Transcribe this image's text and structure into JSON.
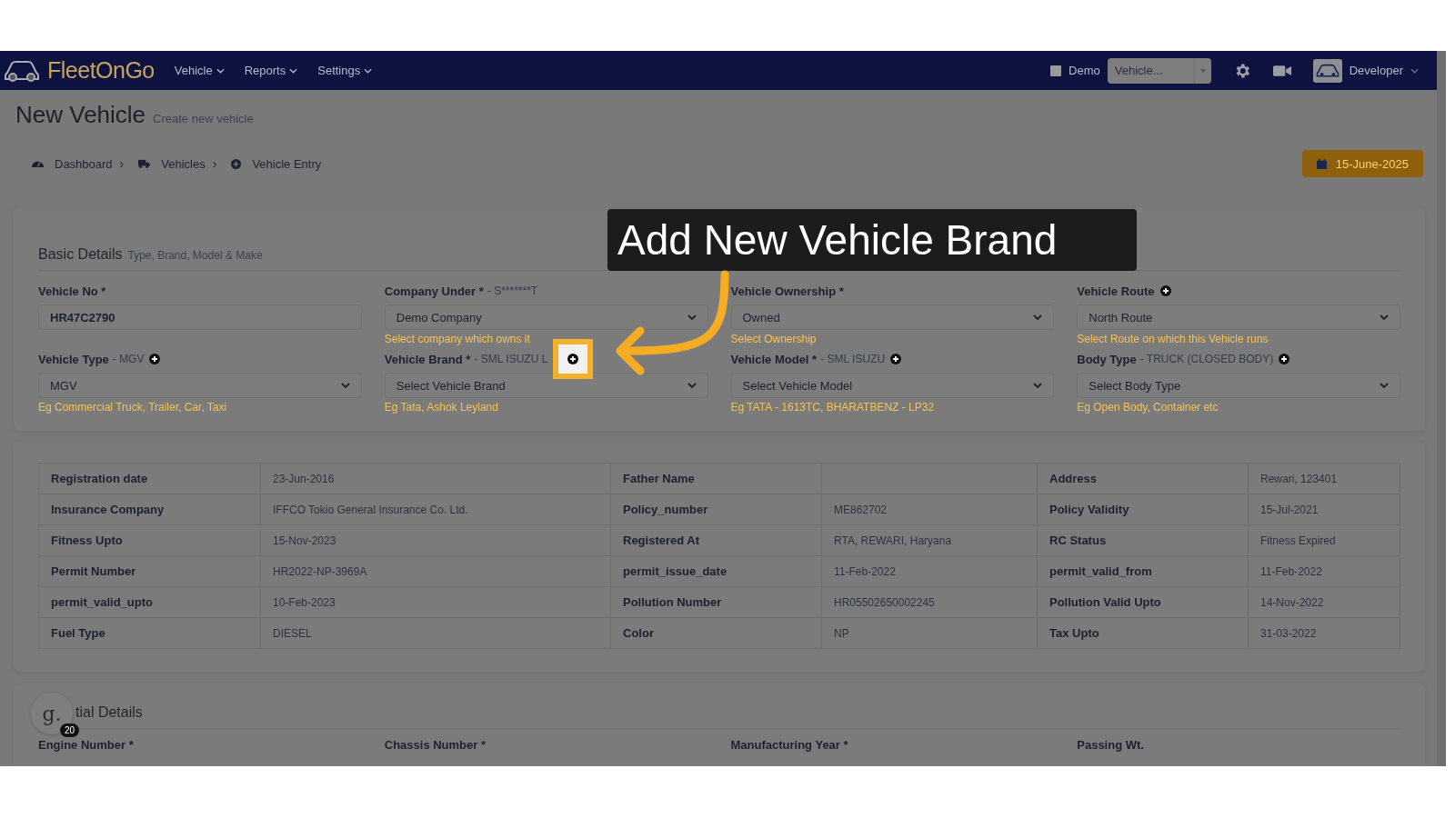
{
  "navbar": {
    "logo": "FleetOnGo",
    "menu": [
      {
        "label": "Vehicle"
      },
      {
        "label": "Reports"
      },
      {
        "label": "Settings"
      }
    ],
    "demo": {
      "label": "Demo",
      "checked": false
    },
    "vehicle_select": {
      "value": "Vehicle..."
    },
    "user": "Developer"
  },
  "page": {
    "title": "New Vehicle",
    "subtitle": "Create new vehicle"
  },
  "breadcrumb": [
    {
      "label": "Dashboard",
      "separator": "›"
    },
    {
      "label": "Vehicles",
      "separator": "›"
    },
    {
      "label": "Vehicle Entry"
    }
  ],
  "date": "15-June-2025",
  "basic": {
    "title": "Basic Details",
    "subtitle": "Type, Brand, Model & Make",
    "fields": [
      {
        "label": "Vehicle No *",
        "kind": "input",
        "value": "HR47C2790",
        "add": false
      },
      {
        "label": "Company Under *",
        "note": "- S*******T",
        "kind": "select",
        "value": "Demo Company",
        "hint": "Select company which owns it",
        "add": false
      },
      {
        "label": "Vehicle Ownership *",
        "kind": "select",
        "value": "Owned",
        "hint": "Select Ownership",
        "add": false
      },
      {
        "label": "Vehicle Route",
        "kind": "select",
        "value": "North Route",
        "hint": "Select Route on which this Vehicle runs",
        "add": true,
        "highlighted": false
      },
      {
        "label": "Vehicle Type",
        "note": "- MGV",
        "kind": "select",
        "value": "MGV",
        "hint": "Eg Commercial Truck, Trailer, Car, Taxi",
        "add": true,
        "highlighted": false
      },
      {
        "label": "Vehicle Brand *",
        "note": "- SML ISUZU L",
        "kind": "select",
        "value": "Select Vehicle Brand",
        "hint": "Eg Tata, Ashok Leyland",
        "add": true,
        "highlighted": true
      },
      {
        "label": "Vehicle Model *",
        "note": "- SML ISUZU",
        "kind": "select",
        "value": "Select Vehicle Model",
        "hint": "Eg TATA - 1613TC, BHARATBENZ - LP32",
        "add": true,
        "highlighted": false
      },
      {
        "label": "Body Type",
        "note": "- TRUCK (CLOSED BODY)",
        "kind": "select",
        "value": "Select Body Type",
        "hint": "Eg Open Body, Container etc",
        "add": true,
        "highlighted": false
      }
    ]
  },
  "details_table": {
    "rows": [
      [
        {
          "label": "Registration date",
          "value": "23-Jun-2016"
        },
        {
          "label": "Father Name"
        },
        {
          "label": "Address",
          "value": "Rewari, 123401"
        }
      ],
      [
        {
          "label": "Insurance Company",
          "value": "IFFCO Tokio General Insurance Co. Ltd."
        },
        {
          "label": "Policy_number",
          "value": "ME862702"
        },
        {
          "label": "Policy Validity",
          "value": "15-Jul-2021"
        }
      ],
      [
        {
          "label": "Fitness Upto",
          "value": "15-Nov-2023"
        },
        {
          "label": "Registered At",
          "value": "RTA, REWARI, Haryana"
        },
        {
          "label": "RC Status",
          "value": "Fitness Expired"
        }
      ],
      [
        {
          "label": "Permit Number",
          "value": "HR2022-NP-3969A"
        },
        {
          "label": "permit_issue_date",
          "value": "11-Feb-2022"
        },
        {
          "label": "permit_valid_from",
          "value": "11-Feb-2022"
        }
      ],
      [
        {
          "label": "permit_valid_upto",
          "value": "10-Feb-2023"
        },
        {
          "label": "Pollution Number",
          "value": "HR05502650002245"
        },
        {
          "label": "Pollution Valid Upto",
          "value": "14-Nov-2022"
        }
      ],
      [
        {
          "label": "Fuel Type",
          "value": "DIESEL"
        },
        {
          "label": "Color",
          "value": "NP"
        },
        {
          "label": "Tax Upto",
          "value": "31-03-2022"
        }
      ]
    ]
  },
  "section3": {
    "title": "tial Details",
    "fields": [
      {
        "label": "Engine Number *"
      },
      {
        "label": "Chassis Number *"
      },
      {
        "label": "Manufacturing Year *"
      },
      {
        "label": "Passing Wt."
      }
    ]
  },
  "callout": "Add New Vehicle Brand",
  "guide_badge": {
    "letter": "g.",
    "count": "20"
  }
}
